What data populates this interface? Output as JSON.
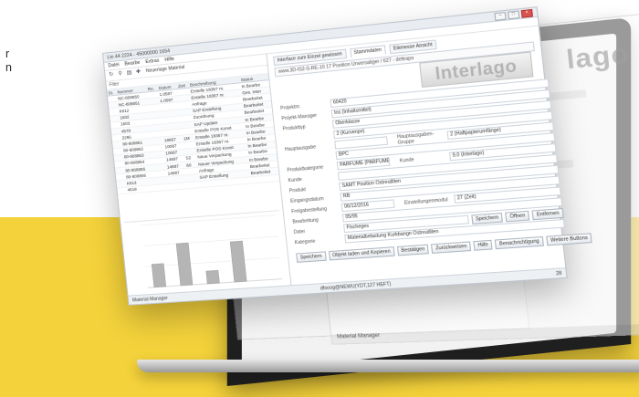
{
  "tagline": [
    "r",
    "n"
  ],
  "window": {
    "title": "Lin 44 2224 - 45000000 1654",
    "menu": [
      "Datei",
      "Bearbe",
      "Extras",
      "Hilfe"
    ],
    "toolbar_label": "Neuerlage Material",
    "filter_label": "Filter",
    "tabs": [
      "Interface zum Einzel gewissen",
      "Stammdaten",
      "Eilenesse Ansicht"
    ],
    "address": "www.3D-IS2-S-RE-10 17 Position Unversatiger / 627 - deltrapo",
    "logo": "Interlago",
    "columns": [
      "St.",
      "Nummer",
      "Re.",
      "Datum",
      "Zeit",
      "Beschreibung",
      "Status"
    ],
    "rows": [
      [
        "",
        "NC-808850",
        "",
        "1.0587",
        "",
        "Erstelle 18367 nr.",
        "In Bearbe"
      ],
      [
        "",
        "NC-808851",
        "",
        "1.0587",
        "",
        "Erstelle 18367 nr.",
        "Ges. Inter"
      ],
      [
        "",
        "K612",
        "",
        "",
        "",
        "Anfrage",
        "Bearbeitet"
      ],
      [
        "",
        "1602",
        "",
        "",
        "",
        "SAP Erstellung",
        "Bearbeitet"
      ],
      [
        "",
        "1603",
        "",
        "",
        "",
        "Zuordnung",
        "Bearbeitet"
      ],
      [
        "",
        "4578",
        "",
        "",
        "",
        "SAP Update",
        "In Bearbe"
      ],
      [
        "",
        "2266",
        "",
        "",
        "",
        "Erstelle POS Konst",
        "In Bearbe"
      ],
      [
        "",
        "80-808851",
        "",
        "18957",
        "1M",
        "Erstelle 18367 nr.",
        "In Bearbe"
      ],
      [
        "",
        "80-808852",
        "",
        "10087",
        "",
        "Erstelle 18367 nr.",
        "In Bearbe"
      ],
      [
        "",
        "80-808853",
        "",
        "10087",
        "",
        "Erstelle POS Konst",
        "In Bearbe"
      ],
      [
        "",
        "80-808854",
        "",
        "14887",
        "S2",
        "Neue Verpackung",
        "In Bearbe"
      ],
      [
        "",
        "80-808855",
        "",
        "14887",
        "60",
        "Neuer Verpackung",
        "In Bearbe"
      ],
      [
        "",
        "80-808856",
        "",
        "14887",
        "",
        "Anfrage",
        "Bearbeitet"
      ],
      [
        "",
        "K613",
        "",
        "",
        "",
        "SAP Erstellung",
        "Bearbeitet"
      ],
      [
        "",
        "4619",
        "",
        "",
        "",
        "",
        ""
      ]
    ],
    "chart_data": {
      "type": "bar",
      "categories": [
        "",
        "",
        "",
        "",
        ""
      ],
      "values": [
        22,
        40,
        12,
        38,
        0
      ],
      "ylim": [
        0,
        60
      ],
      "title": "",
      "xlabel": "",
      "ylabel": ""
    },
    "form": [
      {
        "label": "Projektnr.",
        "value": "60420"
      },
      {
        "label": "Projekt-Manager",
        "value": "Ins (Inhaltsmittel)"
      },
      {
        "label": "Produkttyp",
        "value": "Oberklasse"
      },
      {
        "label": "",
        "value": "2 (Kurvenpe)"
      },
      {
        "label": "Hauptausgabe",
        "value": "",
        "second_label": "Hauptausgaben-Gruppe",
        "second_value": "2 (Haftpapierumfänge)"
      },
      {
        "label": "",
        "value": "BPC"
      },
      {
        "label": "Produktkategorie",
        "value": "PARFUME (PARFUME)",
        "second_label": "Kunde",
        "second_value": "9.0 (Interlago)"
      },
      {
        "label": "Kunde",
        "value": ""
      },
      {
        "label": "Produkt",
        "value": "SAMT Position Ostreutliten"
      },
      {
        "label": "Eingangsdatum",
        "value": "RB"
      },
      {
        "label": "Freigabestellung",
        "value": "06/12/2016",
        "second_label": "Einstellungenmodul",
        "second_value": "27 (Zeit)"
      },
      {
        "label": "Bearbeitung",
        "value": "05/95"
      },
      {
        "label": "Datei",
        "value": "Fischeges"
      },
      {
        "label": "Kategorie",
        "value": "Materialbelastung Kurkbangn Ostreutliten"
      }
    ],
    "file_buttons": [
      "Speichern",
      "Öffnen",
      "Entfernen"
    ],
    "buttons": [
      "Speichern",
      "Objekt laden und Kopieren",
      "Bestätigen",
      "Zurückweisen",
      "Hilfe",
      "Benachrichtigung",
      "Weitere Buttons"
    ],
    "status_left": "Material Manager",
    "status_mid": "dfooog@NEWU(YDT,127 HEFT)",
    "status_right": "28"
  },
  "ghost": {
    "logo": "Interlago",
    "logo2": "lago",
    "taskbar": "Material Manager"
  }
}
